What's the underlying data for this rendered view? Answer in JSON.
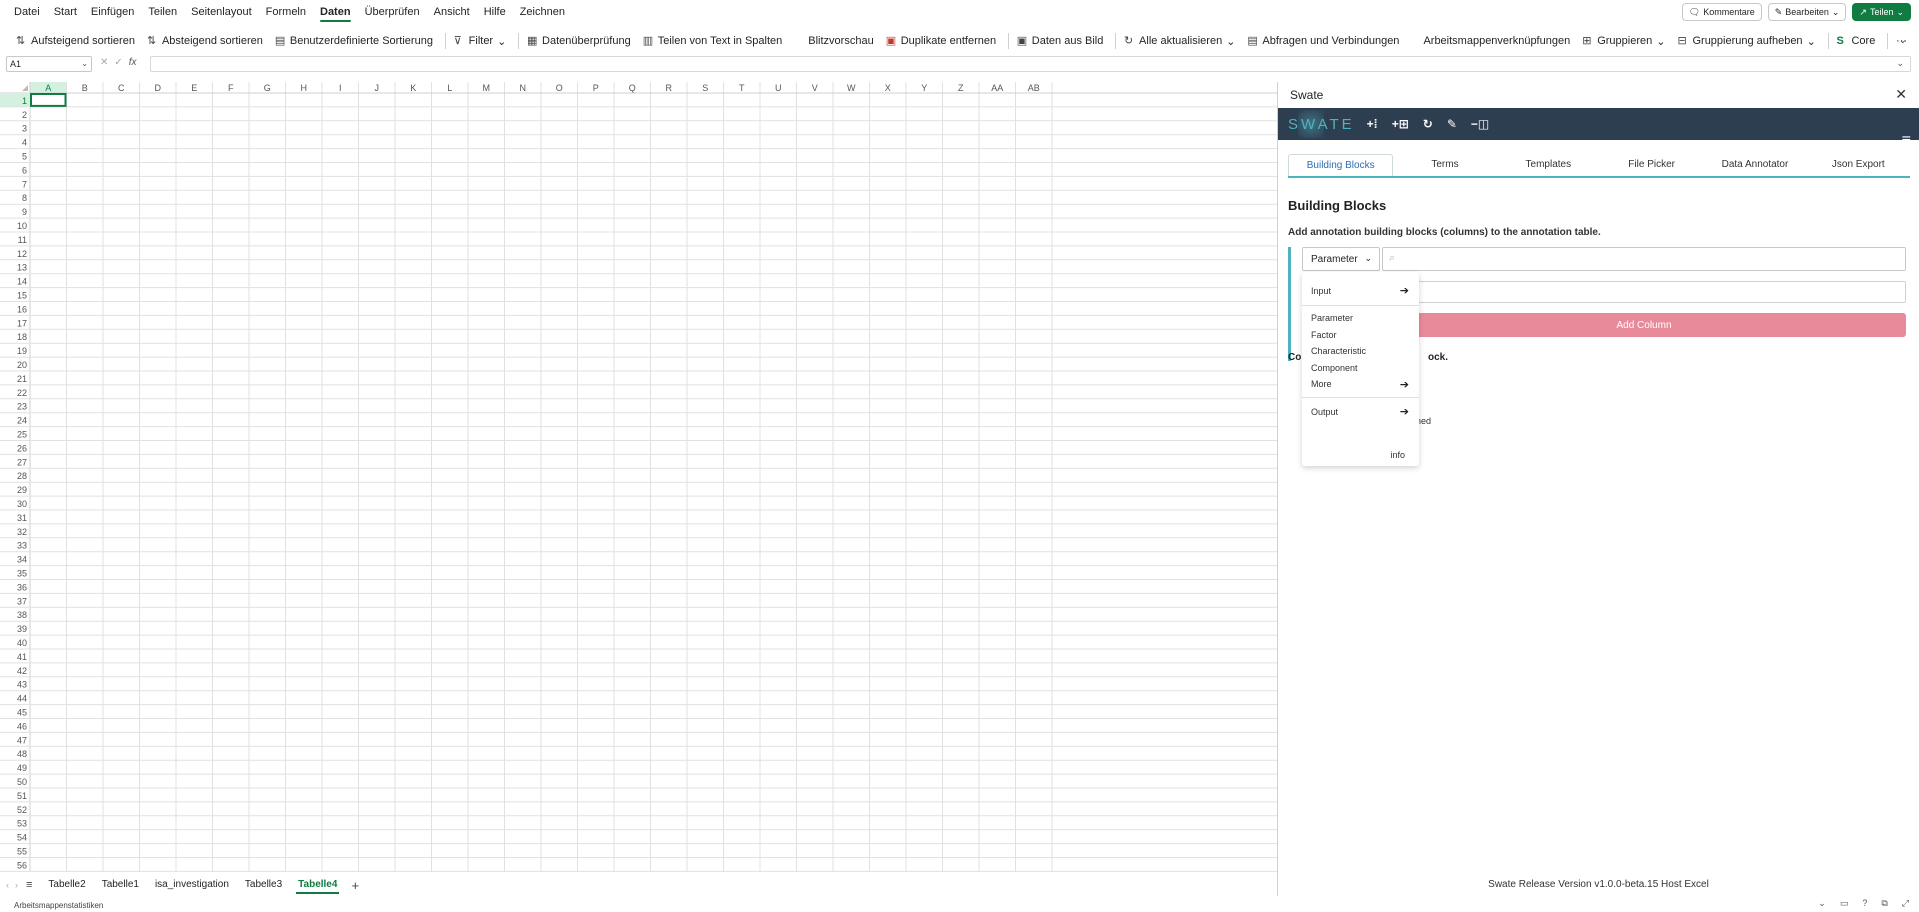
{
  "menu": {
    "items": [
      "Datei",
      "Start",
      "Einfügen",
      "Teilen",
      "Seitenlayout",
      "Formeln",
      "Daten",
      "Überprüfen",
      "Ansicht",
      "Hilfe",
      "Zeichnen"
    ],
    "active": "Daten"
  },
  "top_buttons": {
    "comments": "Kommentare",
    "edit": "Bearbeiten",
    "share": "Teilen"
  },
  "ribbon": {
    "sort_asc": "Aufsteigend sortieren",
    "sort_desc": "Absteigend sortieren",
    "custom_sort": "Benutzerdefinierte Sortierung",
    "filter": "Filter",
    "data_validation": "Datenüberprüfung",
    "text_to_columns": "Teilen von Text in Spalten",
    "flash_fill": "Blitzvorschau",
    "remove_duplicates": "Duplikate entfernen",
    "data_from_picture": "Daten aus Bild",
    "refresh_all": "Alle aktualisieren",
    "queries": "Abfragen und Verbindungen",
    "workbook_links": "Arbeitsmappenverknüpfungen",
    "group": "Gruppieren",
    "ungroup": "Gruppierung aufheben",
    "core": "Core",
    "more": "···"
  },
  "formula_bar": {
    "namebox": "A1",
    "fx": "fx"
  },
  "grid": {
    "columns": [
      "A",
      "B",
      "C",
      "D",
      "E",
      "F",
      "G",
      "H",
      "I",
      "J",
      "K",
      "L",
      "M",
      "N",
      "O",
      "P",
      "Q",
      "R",
      "S",
      "T",
      "U",
      "V",
      "W",
      "X",
      "Y",
      "Z",
      "AA",
      "AB"
    ],
    "row_count": 56,
    "selected_cell": "A1"
  },
  "sheets": {
    "tabs": [
      "Tabelle2",
      "Tabelle1",
      "isa_investigation",
      "Tabelle3",
      "Tabelle4"
    ],
    "active": "Tabelle4",
    "add": "+"
  },
  "statusbar": {
    "text": "Arbeitsmappenstatistiken"
  },
  "pane": {
    "title": "Swate",
    "logo": "SWATE",
    "tabs": [
      "Building Blocks",
      "Terms",
      "Templates",
      "File Picker",
      "Data Annotator",
      "Json Export"
    ],
    "active_tab": "Building Blocks",
    "heading": "Building Blocks",
    "description": "Add annotation building blocks (columns) to the annotation table.",
    "select_value": "Parameter",
    "add_column": "Add Column",
    "partial_text_1": "Co",
    "partial_text_2": "ock.",
    "partial_text_3": "ned",
    "footer": "Swate Release Version v1.0.0-beta.15 Host Excel"
  },
  "dropdown": {
    "input": "Input",
    "items": [
      "Parameter",
      "Factor",
      "Characteristic",
      "Component",
      "More"
    ],
    "output": "Output",
    "info": "info"
  },
  "colors": {
    "excel_green": "#107c41",
    "swate_nav": "#2d3e50",
    "swate_accent": "#4fb3bf",
    "add_column": "#e98a9b",
    "tab_active_text": "#2a6fb2"
  }
}
